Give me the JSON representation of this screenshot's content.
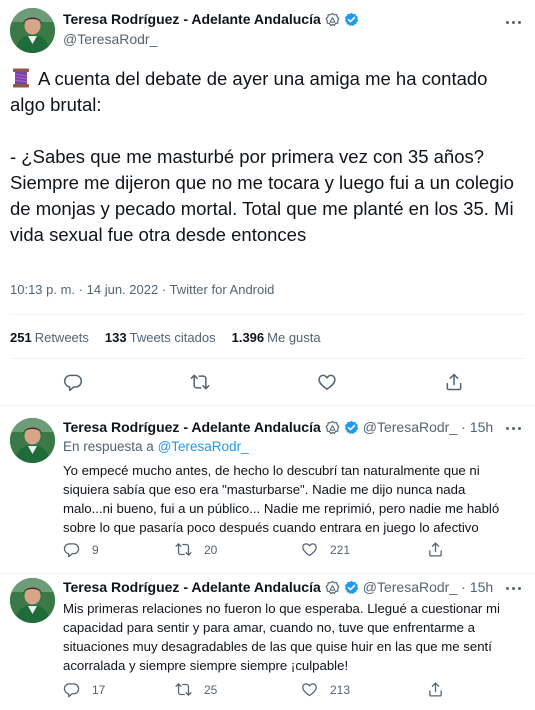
{
  "main_tweet": {
    "author": {
      "display_name": "Teresa Rodríguez - Adelante Andalucía",
      "handle": "@TeresaRodr_"
    },
    "text": "A cuenta del debate de ayer una amiga me ha contado algo brutal:\n\n- ¿Sabes que me masturbé por primera vez con 35 años? Siempre me dijeron que no me tocara y luego fui a un colegio de monjas y pecado mortal. Total que me planté en los 35. Mi vida sexual fue otra desde entonces",
    "time": "10:13 p. m.",
    "date": "14 jun. 2022",
    "source": "Twitter for Android",
    "sep": "·",
    "stats": {
      "retweets": {
        "count": "251",
        "label": "Retweets"
      },
      "quotes": {
        "count": "133",
        "label": "Tweets citados"
      },
      "likes": {
        "count": "1.396",
        "label": "Me gusta"
      }
    }
  },
  "replies": [
    {
      "display_name": "Teresa Rodríguez - Adelante Andalucía",
      "handle": "@TeresaRodr_",
      "time": "15h",
      "reply_prefix": "En respuesta a",
      "reply_handle": "@TeresaRodr_",
      "text": "Yo empecé mucho antes, de hecho lo descubrí tan naturalmente que ni siquiera sabía que eso era \"masturbarse\". Nadie me dijo nunca nada malo...ni bueno, fui a un público... Nadie me reprimió, pero nadie me habló sobre lo que pasaría poco después cuando entrara en juego lo afectivo",
      "reply_count": "9",
      "retweet_count": "20",
      "like_count": "221"
    },
    {
      "display_name": "Teresa Rodríguez - Adelante Andalucía",
      "handle": "@TeresaRodr_",
      "time": "15h",
      "text": "Mis primeras relaciones no fueron lo que esperaba. Llegué a cuestionar mi capacidad para sentir y para amar, cuando no, tuve que enfrentarme a situaciones muy desagradables de las que quise huir en las que me sentí acorralada y siempre siempre siempre ¡culpable!",
      "reply_count": "17",
      "retweet_count": "25",
      "like_count": "213"
    }
  ],
  "colors": {
    "accent": "#1d9bf0",
    "secondary_text": "#536471",
    "border": "#eff3f4"
  },
  "icons": [
    "thread-spool-icon",
    "government-badge-icon",
    "verified-badge-icon",
    "more-icon",
    "reply-icon",
    "retweet-icon",
    "like-icon",
    "share-icon"
  ]
}
